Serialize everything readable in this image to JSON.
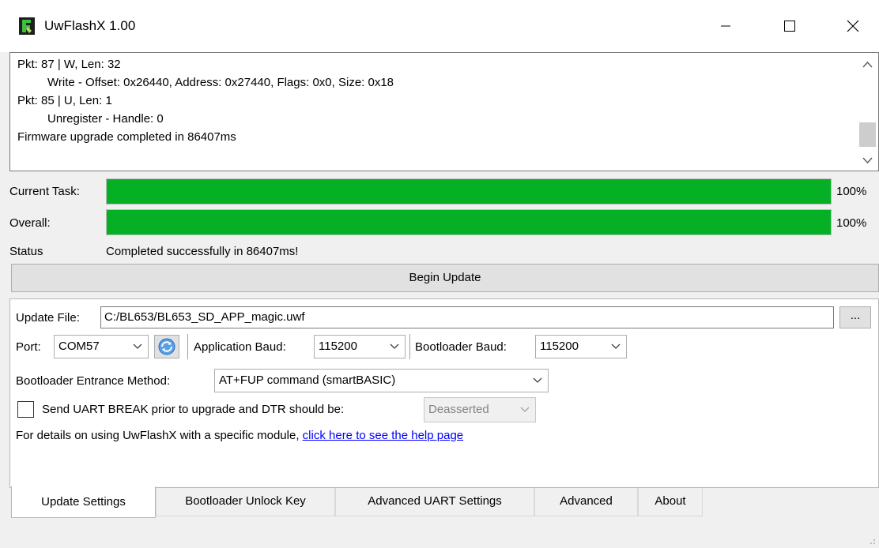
{
  "window": {
    "title": "UwFlashX 1.00"
  },
  "log": {
    "lines": [
      "Pkt: 87 | W, Len: 32",
      "Write - Offset: 0x26440, Address: 0x27440, Flags: 0x0, Size: 0x18",
      "Pkt: 85 | U, Len: 1",
      "Unregister - Handle: 0",
      "Firmware upgrade completed in 86407ms"
    ]
  },
  "progress": {
    "current_label": "Current Task:",
    "current_value": 100,
    "current_pct": "100%",
    "overall_label": "Overall:",
    "overall_value": 100,
    "overall_pct": "100%",
    "status_label": "Status",
    "status_text": "Completed successfully in 86407ms!",
    "fill_color": "#06b025"
  },
  "begin_update_label": "Begin Update",
  "settings": {
    "update_file_label": "Update File:",
    "update_file_value": "C:/BL653/BL653_SD_APP_magic.uwf",
    "browse_label": "...",
    "port_label": "Port:",
    "port_value": "COM57",
    "app_baud_label": "Application Baud:",
    "app_baud_value": "115200",
    "boot_baud_label": "Bootloader Baud:",
    "boot_baud_value": "115200",
    "entrance_label": "Bootloader Entrance Method:",
    "entrance_value": "AT+FUP command (smartBASIC)",
    "break_label": "Send UART BREAK prior to upgrade and DTR should be:",
    "dtr_value": "Deasserted",
    "help_text": "For details on using UwFlashX with a specific module,",
    "help_link": "click here to see the help page"
  },
  "tabs": [
    {
      "label": "Update Settings"
    },
    {
      "label": "Bootloader Unlock Key"
    },
    {
      "label": "Advanced UART Settings"
    },
    {
      "label": "Advanced"
    },
    {
      "label": "About"
    }
  ]
}
